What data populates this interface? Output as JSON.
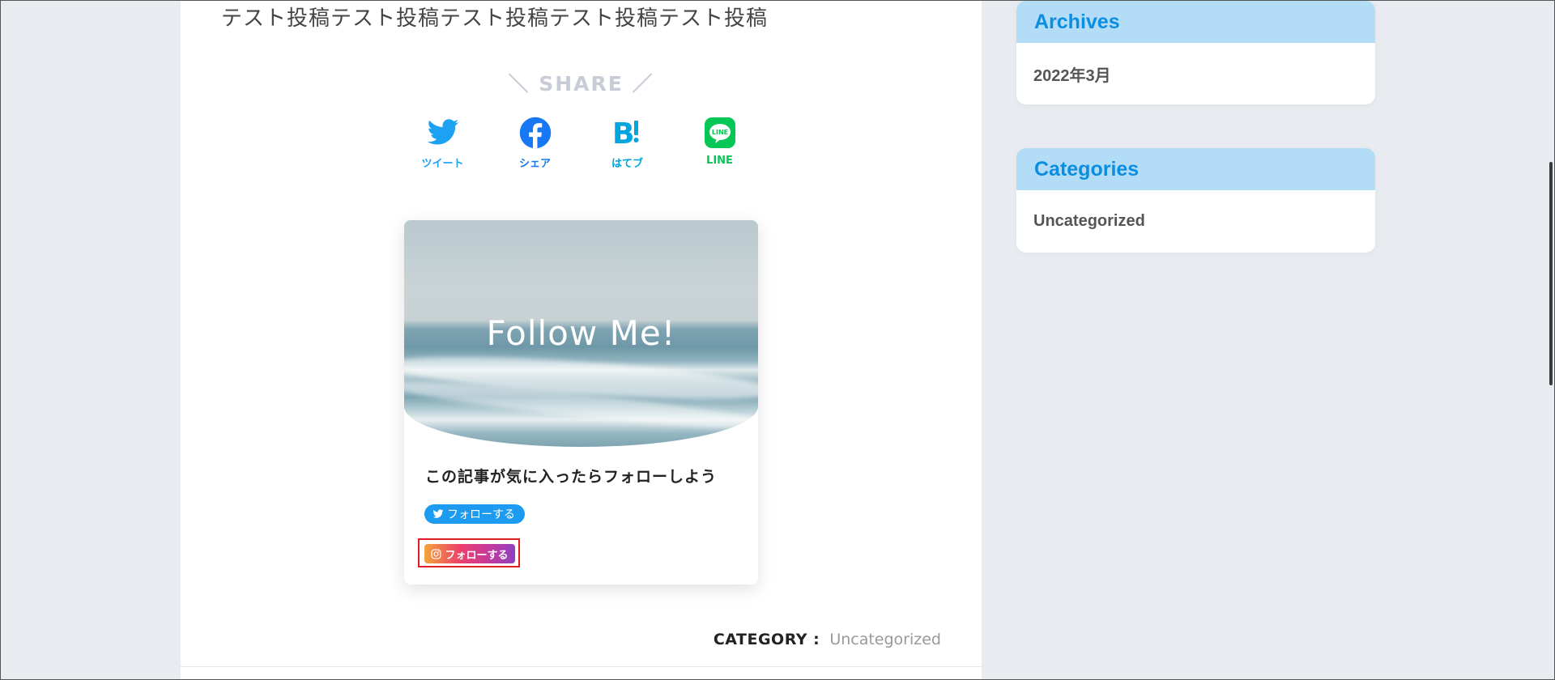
{
  "article": {
    "body_text": "テスト投稿テスト投稿テスト投稿テスト投稿テスト投稿"
  },
  "share": {
    "heading": "＼ SHARE ／",
    "buttons": [
      {
        "label": "ツイート",
        "icon": "twitter-icon",
        "color": "#1da1f2"
      },
      {
        "label": "シェア",
        "icon": "facebook-icon",
        "color": "#1877f2"
      },
      {
        "label": "はてブ",
        "icon": "hatena-bookmark-icon",
        "color": "#00a4de"
      },
      {
        "label": "LINE",
        "icon": "line-icon",
        "color": "#06c755"
      }
    ]
  },
  "follow_card": {
    "title": "Follow Me!",
    "message": "この記事が気に入ったらフォローしよう",
    "twitter_button": "フォローする",
    "instagram_button": "フォローする"
  },
  "category": {
    "label": "CATEGORY :",
    "value": "Uncategorized"
  },
  "sidebar": {
    "archives": {
      "title": "Archives",
      "items": [
        "2022年3月"
      ]
    },
    "categories": {
      "title": "Categories",
      "items": [
        "Uncategorized"
      ]
    }
  },
  "colors": {
    "widget_header_bg": "#b3dcf7",
    "widget_header_text": "#0b8de0",
    "highlight_border": "#e21b24"
  }
}
